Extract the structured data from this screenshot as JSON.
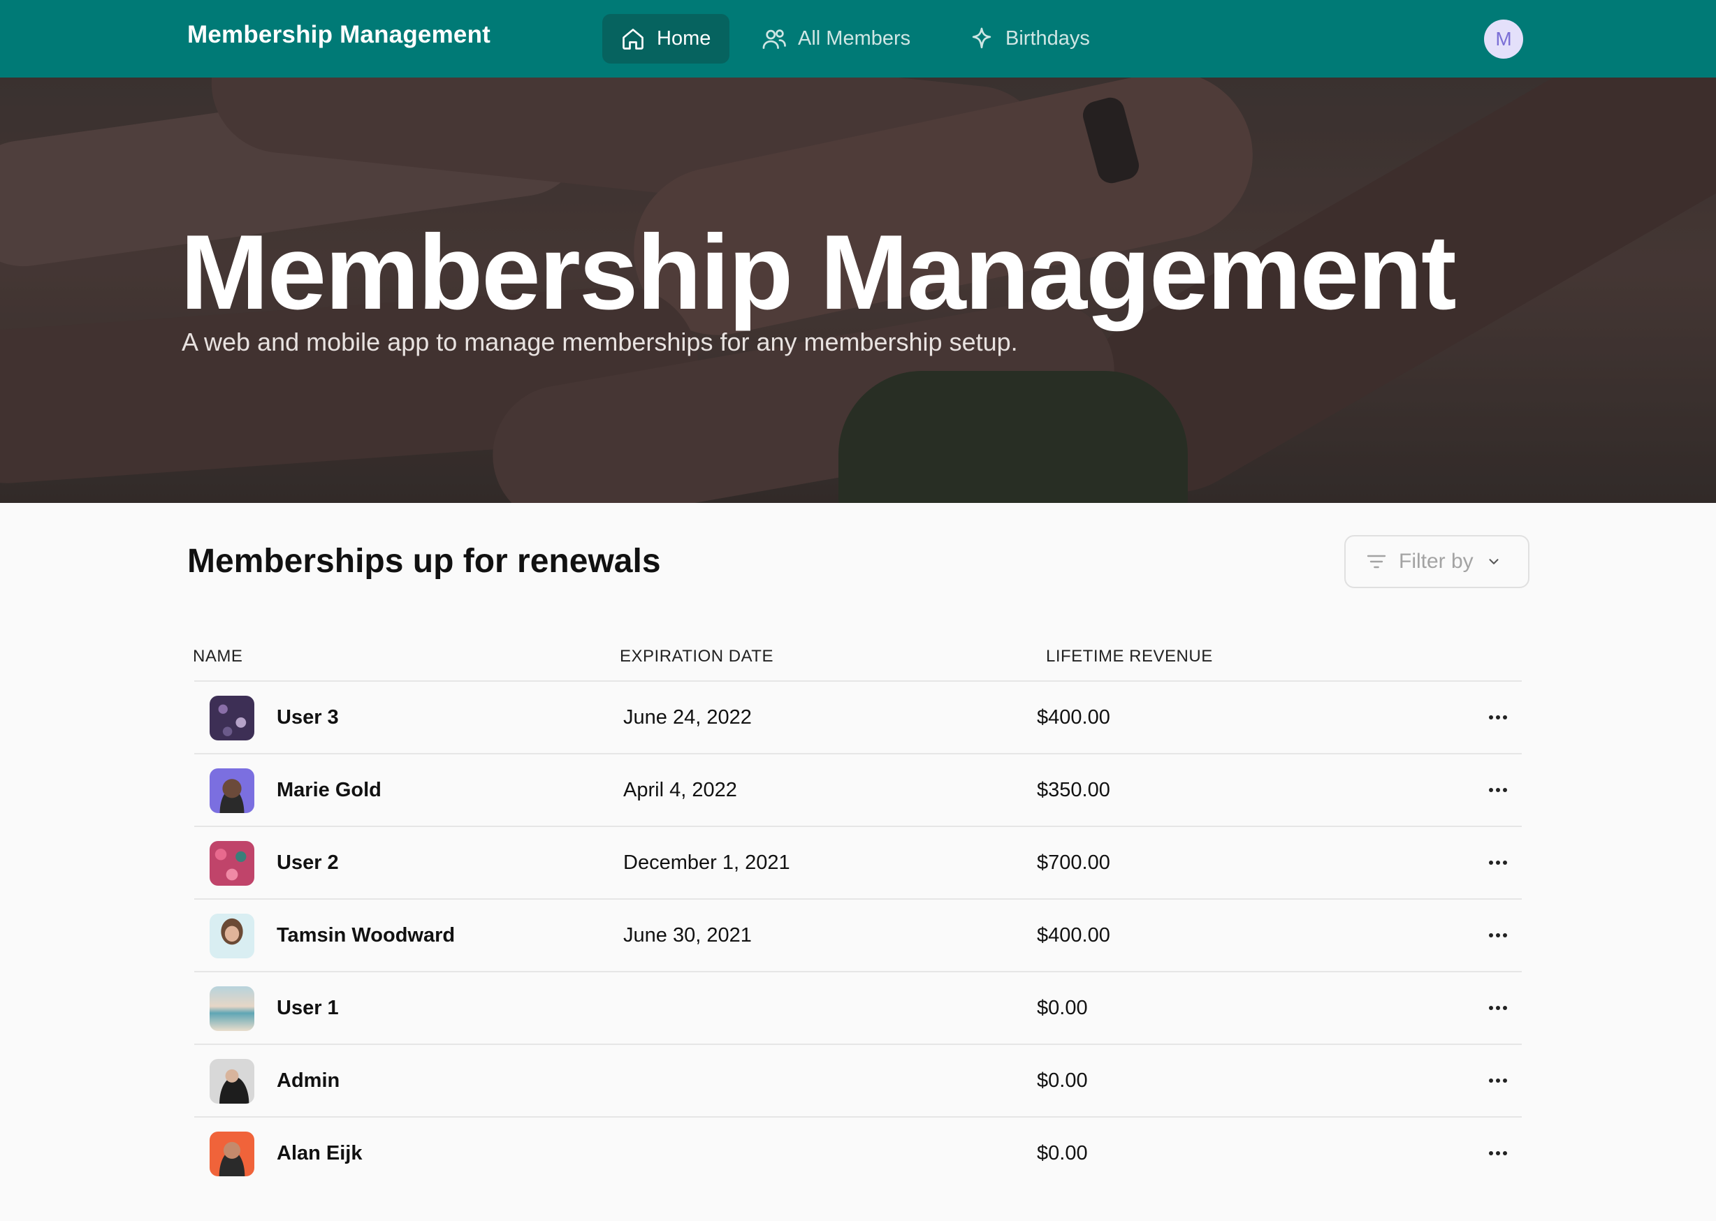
{
  "app": {
    "title": "Membership Management"
  },
  "nav": {
    "items": [
      {
        "label": "Home",
        "icon": "home-icon",
        "active": true
      },
      {
        "label": "All Members",
        "icon": "users-icon",
        "active": false
      },
      {
        "label": "Birthdays",
        "icon": "sparkle-icon",
        "active": false
      }
    ],
    "avatar_initial": "M"
  },
  "hero": {
    "title": "Membership Management",
    "subtitle": "A web and mobile app to manage memberships for any membership setup."
  },
  "section": {
    "title": "Memberships up for renewals",
    "filter_label": "Filter by"
  },
  "table": {
    "columns": [
      "NAME",
      "EXPIRATION DATE",
      "LIFETIME REVENUE"
    ],
    "rows": [
      {
        "name": "User 3",
        "expiration": "June 24, 2022",
        "revenue": "$400.00",
        "avatar_color": "#3d2f55"
      },
      {
        "name": "Marie Gold",
        "expiration": "April 4, 2022",
        "revenue": "$350.00",
        "avatar_color": "#7b6fe0"
      },
      {
        "name": "User 2",
        "expiration": "December 1, 2021",
        "revenue": "$700.00",
        "avatar_color": "#c0446a"
      },
      {
        "name": "Tamsin Woodward",
        "expiration": "June 30, 2021",
        "revenue": "$400.00",
        "avatar_color": "#d9eef2"
      },
      {
        "name": "User 1",
        "expiration": "",
        "revenue": "$0.00",
        "avatar_color": "#a9c9d3"
      },
      {
        "name": "Admin",
        "expiration": "",
        "revenue": "$0.00",
        "avatar_color": "#d8d8d8"
      },
      {
        "name": "Alan Eijk",
        "expiration": "",
        "revenue": "$0.00",
        "avatar_color": "#f0633a"
      }
    ]
  },
  "colors": {
    "nav_bg": "#007a76",
    "nav_active": "#06635f"
  }
}
